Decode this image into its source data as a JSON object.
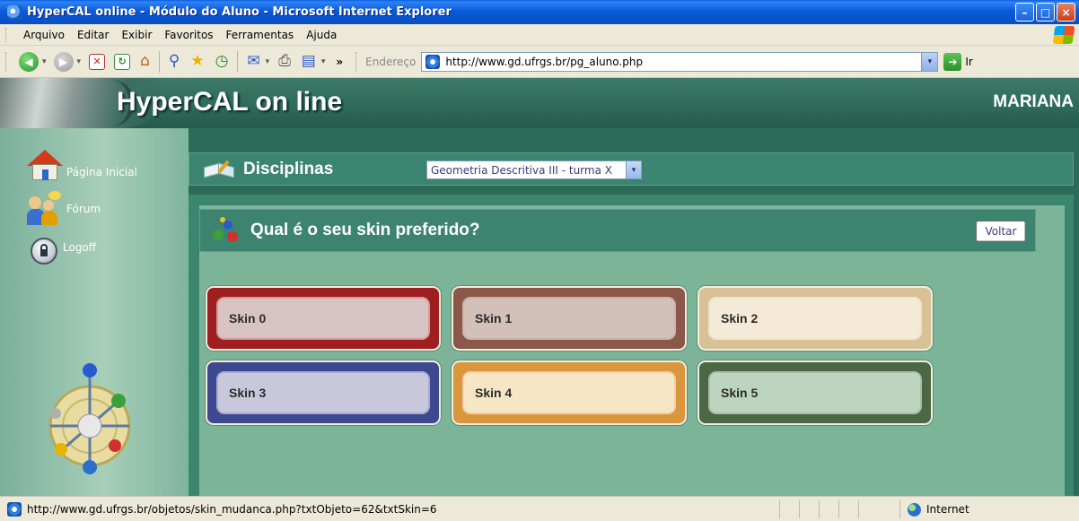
{
  "window": {
    "title": "HyperCAL online - Módulo do Aluno - Microsoft Internet Explorer",
    "controls": {
      "minimize": "–",
      "maximize": "□",
      "close": "×"
    }
  },
  "menu": {
    "items": [
      "Arquivo",
      "Editar",
      "Exibir",
      "Favoritos",
      "Ferramentas",
      "Ajuda"
    ]
  },
  "toolbar": {
    "back_glyph": "◀",
    "forward_glyph": "▶",
    "dropdown_glyph": "▾",
    "stop_glyph": "✕",
    "refresh_glyph": "↻",
    "home_glyph": "⌂",
    "search_glyph": "⚲",
    "favorites_glyph": "★",
    "history_glyph": "◷",
    "mail_glyph": "✉",
    "print_glyph": "⎙",
    "edit_glyph": "▤",
    "overflow_glyph": "»",
    "address_label": "Endereço",
    "address_value": "http://www.gd.ufrgs.br/pg_aluno.php",
    "address_dropdown": "▾",
    "go_glyph": "➔",
    "go_label": "Ir"
  },
  "page": {
    "site_title": "HyperCAL on line",
    "user_name": "MARIANA",
    "sidebar": {
      "items": [
        {
          "label": "Página Inicial",
          "icon": "house-icon"
        },
        {
          "label": "Fórum",
          "icon": "forum-icon"
        },
        {
          "label": "Logoff",
          "icon": "lock-icon"
        }
      ]
    },
    "disciplinas": {
      "label": "Disciplinas",
      "selected": "Geometria Descritiva III - turma X",
      "dropdown_glyph": "▾"
    },
    "skin_panel": {
      "question": "Qual é o seu skin preferido?",
      "back_label": "Voltar",
      "skins": [
        {
          "label": "Skin 0",
          "outer": "#9e1f1f",
          "inner": "#d8c3c3"
        },
        {
          "label": "Skin 1",
          "outer": "#8a5748",
          "inner": "#d3c0b9"
        },
        {
          "label": "Skin 2",
          "outer": "#d9c196",
          "inner": "#f4ead7"
        },
        {
          "label": "Skin 3",
          "outer": "#3e4891",
          "inner": "#c7c8dc"
        },
        {
          "label": "Skin 4",
          "outer": "#d9963c",
          "inner": "#f6e6c5"
        },
        {
          "label": "Skin 5",
          "outer": "#4a6845",
          "inner": "#bdd4be"
        }
      ]
    }
  },
  "statusbar": {
    "url": "http://www.gd.ufrgs.br/objetos/skin_mudanca.php?txtObjeto=62&txtSkin=6",
    "zone": "Internet"
  }
}
